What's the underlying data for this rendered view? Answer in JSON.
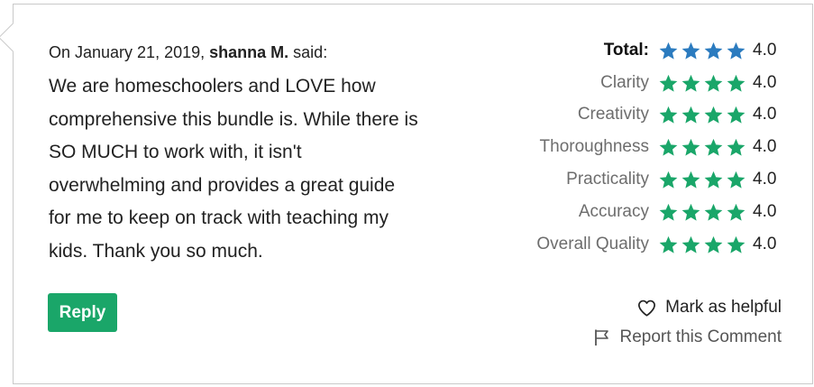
{
  "review": {
    "date_prefix": "On January 21, 2019,",
    "author": "shanna M.",
    "said": "said:",
    "body": "We are homeschoolers and LOVE how\ncomprehensive this bundle is.  While there is\nSO MUCH to work with, it isn't\noverwhelming and provides a great guide\nfor me to keep on track with teaching my\nkids.  Thank you so much.",
    "reply_label": "Reply"
  },
  "ratings": [
    {
      "label": "Total:",
      "stars": 4,
      "value": "4.0",
      "color": "#2b7bbf"
    },
    {
      "label": "Clarity",
      "stars": 4,
      "value": "4.0",
      "color": "#1aa669"
    },
    {
      "label": "Creativity",
      "stars": 4,
      "value": "4.0",
      "color": "#1aa669"
    },
    {
      "label": "Thoroughness",
      "stars": 4,
      "value": "4.0",
      "color": "#1aa669"
    },
    {
      "label": "Practicality",
      "stars": 4,
      "value": "4.0",
      "color": "#1aa669"
    },
    {
      "label": "Accuracy",
      "stars": 4,
      "value": "4.0",
      "color": "#1aa669"
    },
    {
      "label": "Overall Quality",
      "stars": 4,
      "value": "4.0",
      "color": "#1aa669"
    }
  ],
  "actions": {
    "helpful_label": "Mark as helpful",
    "helpful_icon": "heart-outline-icon",
    "report_label": "Report this Comment",
    "report_icon": "flag-outline-icon"
  },
  "colors": {
    "accent_green": "#1aa669",
    "total_blue": "#2b7bbf"
  }
}
